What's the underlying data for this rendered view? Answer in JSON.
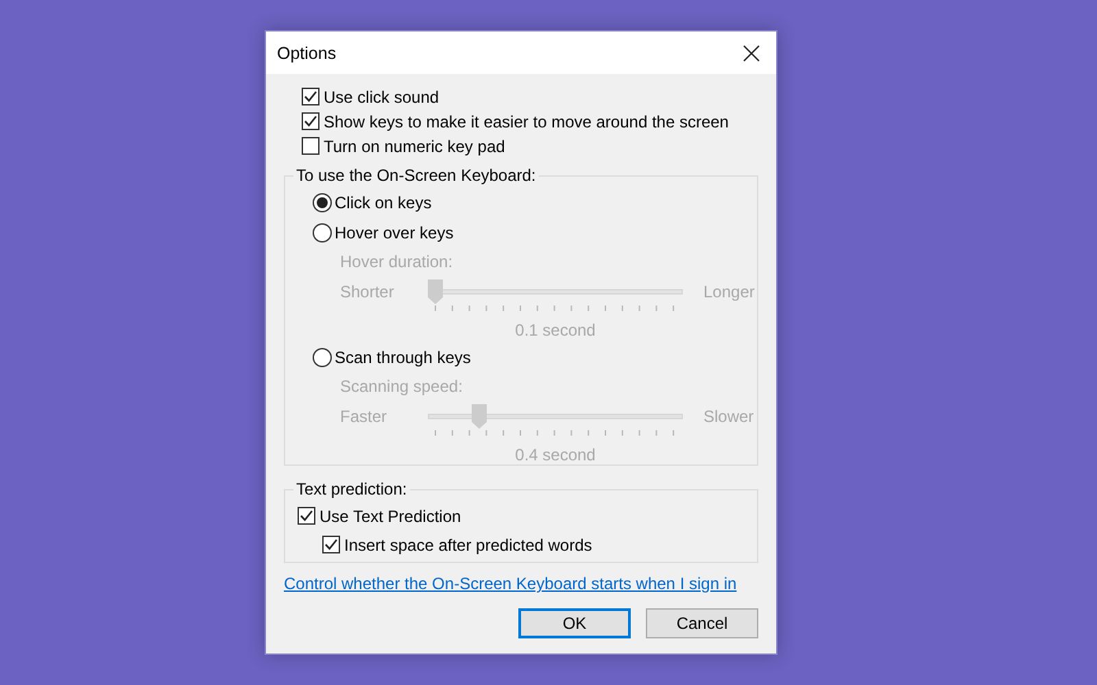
{
  "window": {
    "title": "Options"
  },
  "options": [
    {
      "label": "Use click sound",
      "checked": true
    },
    {
      "label": "Show keys to make it easier to move around the screen",
      "checked": true
    },
    {
      "label": "Turn on numeric key pad",
      "checked": false
    }
  ],
  "keyboard_group": {
    "legend": "To use the On-Screen Keyboard:",
    "modes": [
      {
        "label": "Click on keys",
        "selected": true
      },
      {
        "label": "Hover over keys",
        "selected": false,
        "slider": {
          "caption": "Hover duration:",
          "min_label": "Shorter",
          "max_label": "Longer",
          "level": 0,
          "reading": "0.1 second",
          "disabled": true
        }
      },
      {
        "label": "Scan through keys",
        "selected": false,
        "slider": {
          "caption": "Scanning speed:",
          "min_label": "Faster",
          "max_label": "Slower",
          "level": 0.18,
          "reading": "0.4 second",
          "disabled": true
        }
      }
    ]
  },
  "prediction_group": {
    "legend": "Text prediction:",
    "items": [
      {
        "label": "Use Text Prediction",
        "checked": true,
        "children": [
          {
            "label": "Insert space after predicted words",
            "checked": true
          }
        ]
      }
    ]
  },
  "link": "Control whether the On-Screen Keyboard starts when I sign in",
  "buttons": [
    {
      "label": "OK",
      "default": true
    },
    {
      "label": "Cancel",
      "default": false
    }
  ]
}
